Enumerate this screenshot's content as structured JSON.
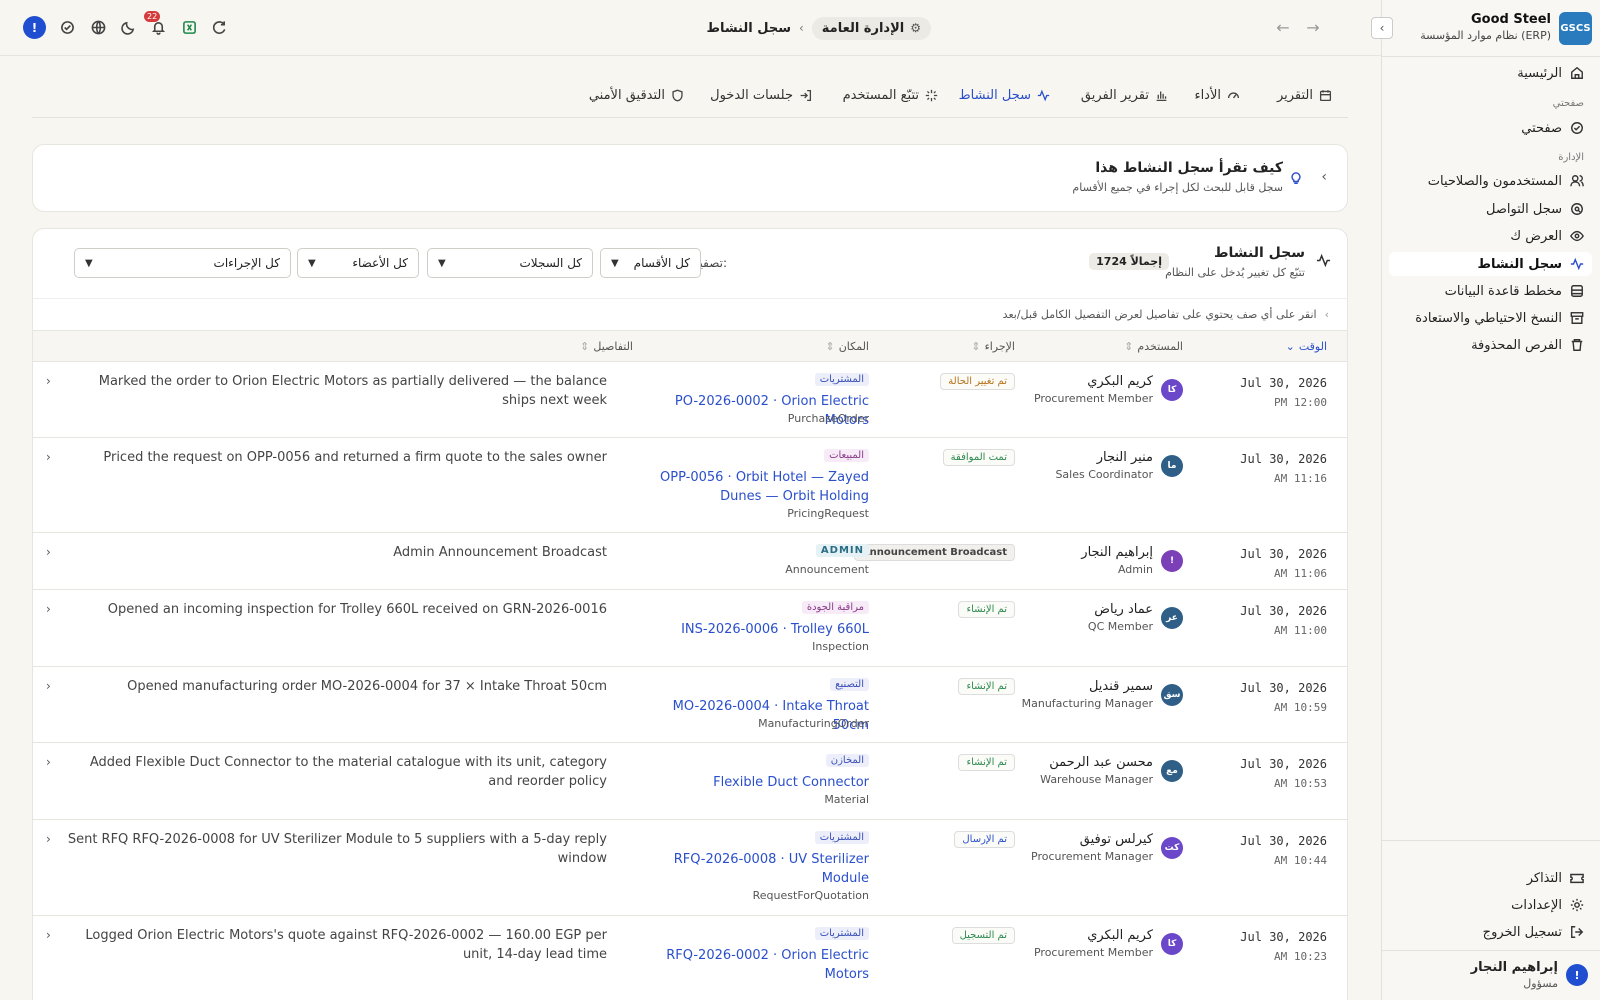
{
  "brand": {
    "logo": "GSCS",
    "name": "Good Steel",
    "subtitle": "نظام موارد المؤسسة (ERP)"
  },
  "sidebar": {
    "home": "الرئيسية",
    "section_my_page": "صفحتي",
    "my_page": "صفحتي",
    "section_admin": "الإدارة",
    "items": [
      {
        "label": "المستخدمون والصلاحيات",
        "icon": "users-icon"
      },
      {
        "label": "سجل التواصل",
        "icon": "chat-search-icon"
      },
      {
        "label": "العرض ك",
        "icon": "eye-icon"
      },
      {
        "label": "سجل النشاط",
        "icon": "activity-icon"
      },
      {
        "label": "مخطط قاعدة البيانات",
        "icon": "database-icon"
      },
      {
        "label": "النسخ الاحتياطي والاستعادة",
        "icon": "archive-icon"
      },
      {
        "label": "الفرص المحذوفة",
        "icon": "trash-icon"
      }
    ],
    "bottom": [
      {
        "label": "التذاكر",
        "icon": "ticket-icon"
      },
      {
        "label": "الإعدادات",
        "icon": "gear-icon"
      },
      {
        "label": "تسجيل الخروج",
        "icon": "logout-icon"
      }
    ],
    "user": {
      "initial": "!",
      "name": "إبراهيم النجار",
      "role": "مسؤول"
    }
  },
  "topbar": {
    "breadcrumb_parent": "الإدارة العامة",
    "breadcrumb_current": "سجل النشاط",
    "notification_count": "22",
    "alert_glyph": "!"
  },
  "tabs": [
    {
      "label": "التقرير",
      "icon": "calendar-icon"
    },
    {
      "label": "الأداء",
      "icon": "gauge-icon"
    },
    {
      "label": "تقرير الفريق",
      "icon": "bar-chart-icon"
    },
    {
      "label": "سجل النشاط",
      "icon": "activity-icon"
    },
    {
      "label": "تتبّع المستخدم",
      "icon": "sparkle-icon"
    },
    {
      "label": "جلسات الدخول",
      "icon": "login-icon"
    },
    {
      "label": "التدقيق الأمني",
      "icon": "shield-icon"
    }
  ],
  "info": {
    "title": "كيف تقرأ سجل النشاط هذا",
    "subtitle": "سجل قابل للبحث لكل إجراء في جميع الأقسام"
  },
  "log": {
    "title": "سجل النشاط",
    "subtitle": "تتبّع كل تغيير يُدخل على النظام",
    "total": "1724 إجمالاً",
    "filter_label": "تصفية:",
    "filters": {
      "sections": "كل الأقسام",
      "records": "كل السجلات",
      "members": "كل الأعضاء",
      "actions": "كل الإجراءات"
    },
    "hint": "انقر على أي صف يحتوي على تفاصيل لعرض التفصيل الكامل قبل/بعد",
    "columns": {
      "time": "الوقت",
      "user": "المستخدم",
      "action": "الإجراء",
      "place": "المكان",
      "details": "التفاصيل"
    },
    "rows": [
      {
        "date": "Jul 30, 2026",
        "time": "PM 12:00",
        "initials": "كا",
        "avatar_color": "#6b47c9",
        "user": "كريم البكري",
        "role": "Procurement Member",
        "action": "تم تغيير الحالة",
        "action_color": "#b8731a",
        "tag": "المشتريات",
        "tag_color": "#3a4fb8",
        "tag_bg": "#eceefa",
        "link": "PO-2026-0002 · Orion Electric Motors",
        "type": "PurchaseOrder",
        "details": "Marked the order to Orion Electric Motors as partially delivered — the balance ships next week"
      },
      {
        "date": "Jul 30, 2026",
        "time": "AM 11:16",
        "initials": "ما",
        "avatar_color": "#2f5e86",
        "user": "منير النجار",
        "role": "Sales Coordinator",
        "action": "تمت الموافقة",
        "action_color": "#2c8a4f",
        "tag": "المبيعات",
        "tag_color": "#8a3a8a",
        "tag_bg": "#f6ebf6",
        "link": "OPP-0056 · Orbit Hotel — Zayed Dunes — Orbit Holding",
        "type": "PricingRequest",
        "details": "Priced the request on OPP-0056 and returned a firm quote to the sales owner"
      },
      {
        "date": "Jul 30, 2026",
        "time": "AM 11:06",
        "initials": "!",
        "avatar_color": "#7b3fb8",
        "user": "إبراهيم النجار",
        "role": "Admin",
        "action": "Announcement Broadcast",
        "action_color": "#444",
        "tag": "ADMIN",
        "tag_color": "#2a6e86",
        "tag_bg": "#e6f1f5",
        "link": "",
        "type": "Announcement",
        "details": "Admin Announcement Broadcast"
      },
      {
        "date": "Jul 30, 2026",
        "time": "AM 11:00",
        "initials": "عر",
        "avatar_color": "#2f5e86",
        "user": "عماد رياض",
        "role": "QC Member",
        "action": "تم الإنشاء",
        "action_color": "#2c8a4f",
        "tag": "مراقبة الجودة",
        "tag_color": "#8a3a8a",
        "tag_bg": "#f6ebf6",
        "link": "INS-2026-0006 · Trolley 660L",
        "type": "Inspection",
        "details": "Opened an incoming inspection for Trolley 660L received on GRN-2026-0016"
      },
      {
        "date": "Jul 30, 2026",
        "time": "AM 10:59",
        "initials": "سق",
        "avatar_color": "#2f5e86",
        "user": "سمير قنديل",
        "role": "Manufacturing Manager",
        "action": "تم الإنشاء",
        "action_color": "#2c8a4f",
        "tag": "التصنيع",
        "tag_color": "#3a4fb8",
        "tag_bg": "#eceefa",
        "link": "MO-2026-0004 · Intake Throat 50cm",
        "type": "ManufacturingOrder",
        "details": "Opened manufacturing order MO-2026-0004 for 37 × Intake Throat 50cm"
      },
      {
        "date": "Jul 30, 2026",
        "time": "AM 10:53",
        "initials": "مع",
        "avatar_color": "#2f5e86",
        "user": "محسن عبد الرحمن",
        "role": "Warehouse Manager",
        "action": "تم الإنشاء",
        "action_color": "#2c8a4f",
        "tag": "المخازن",
        "tag_color": "#3a4fb8",
        "tag_bg": "#eceefa",
        "link": "Flexible Duct Connector",
        "type": "Material",
        "details": "Added Flexible Duct Connector to the material catalogue with its unit, category and reorder policy"
      },
      {
        "date": "Jul 30, 2026",
        "time": "AM 10:44",
        "initials": "كت",
        "avatar_color": "#6b47c9",
        "user": "كيرلس توفيق",
        "role": "Procurement Manager",
        "action": "تم الإرسال",
        "action_color": "#2a4fcc",
        "tag": "المشتريات",
        "tag_color": "#3a4fb8",
        "tag_bg": "#eceefa",
        "link": "RFQ-2026-0008 · UV Sterilizer Module",
        "type": "RequestForQuotation",
        "details": "Sent RFQ RFQ-2026-0008 for UV Sterilizer Module to 5 suppliers with a 5-day reply window"
      },
      {
        "date": "Jul 30, 2026",
        "time": "AM 10:23",
        "initials": "كا",
        "avatar_color": "#6b47c9",
        "user": "كريم البكري",
        "role": "Procurement Member",
        "action": "تم التسجيل",
        "action_color": "#2c8a4f",
        "tag": "المشتريات",
        "tag_color": "#3a4fb8",
        "tag_bg": "#eceefa",
        "link": "RFQ-2026-0002 · Orion Electric Motors",
        "type": "",
        "details": "Logged Orion Electric Motors's quote against RFQ-2026-0002 — 160.00 EGP per unit, 14-day lead time"
      }
    ]
  }
}
